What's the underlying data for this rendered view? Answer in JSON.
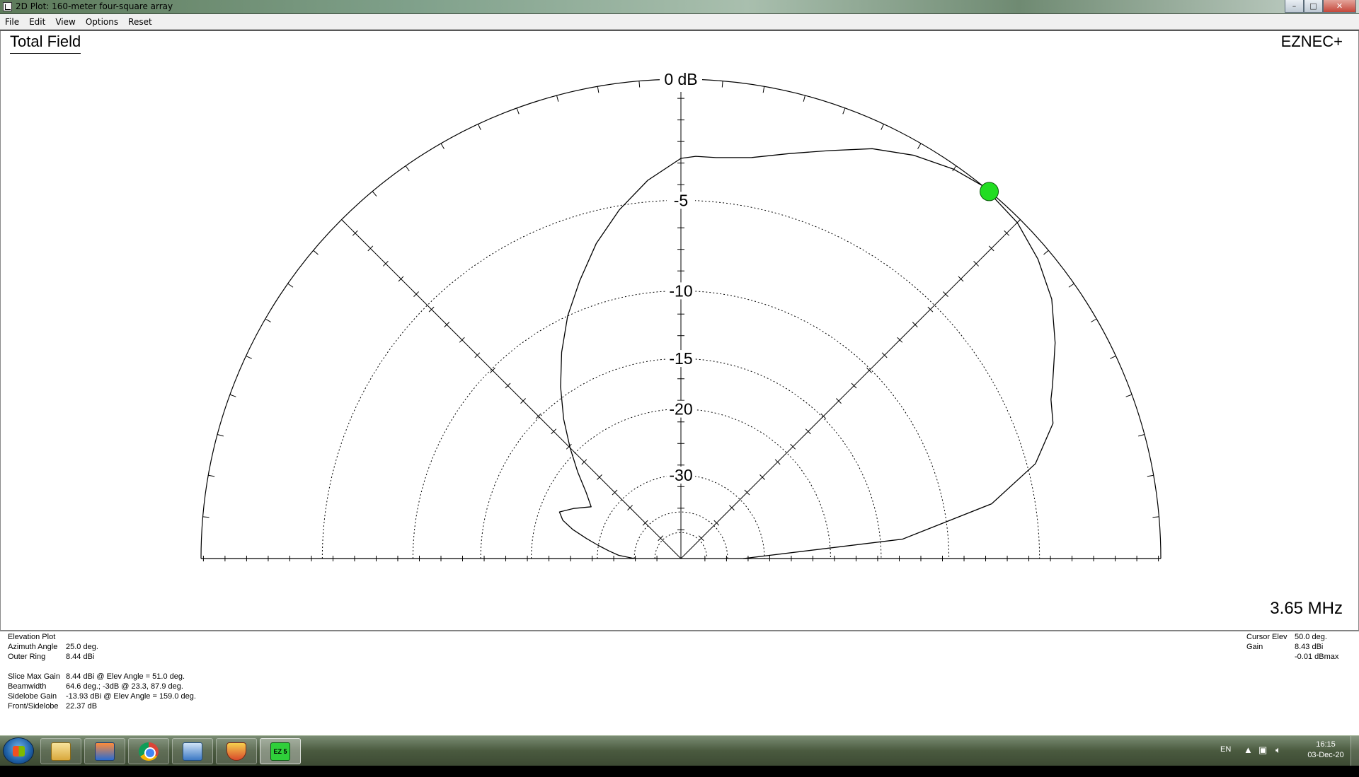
{
  "window": {
    "title": "2D Plot: 160-meter four-square array",
    "minimize_glyph": "–",
    "maximize_glyph": "□",
    "close_glyph": "✕"
  },
  "menu": [
    "File",
    "Edit",
    "View",
    "Options",
    "Reset"
  ],
  "plot": {
    "title": "Total Field",
    "program": "EZNEC+",
    "frequency": "3.65 MHz",
    "cursor_color": "#22dd22"
  },
  "chart_data": {
    "type": "polar",
    "projection": "elevation half-plane",
    "ring_labels": [
      "0 dB",
      "-5",
      "-10",
      "-15",
      "-20",
      "-30"
    ],
    "ring_values_db": [
      0,
      -5,
      -10,
      -15,
      -20,
      -30
    ],
    "extra_rings_db": [
      -40,
      -50
    ],
    "angle_range_deg": [
      0,
      180
    ],
    "cursor": {
      "elevation_deg": 50.0,
      "gain_db_rel_max": -0.01
    },
    "pattern": {
      "elevation_deg": [
        0,
        5,
        10,
        15,
        20,
        23.3,
        25,
        30,
        35,
        40,
        45,
        51,
        55,
        60,
        65,
        70,
        75,
        80,
        85,
        87.9,
        90,
        95,
        100,
        105,
        110,
        115,
        120,
        125,
        130,
        135,
        140,
        145,
        150,
        155,
        159,
        162,
        165,
        168,
        171,
        174,
        177,
        180
      ],
      "gain_db_rel_max": [
        -35,
        -13.2,
        -7.2,
        -4.6,
        -3.3,
        -3.0,
        -2.7,
        -1.8,
        -1.0,
        -0.5,
        -0.15,
        0,
        -0.15,
        -0.5,
        -1.0,
        -1.7,
        -2.3,
        -2.8,
        -3.0,
        -3.0,
        -3.1,
        -4.0,
        -5.2,
        -6.6,
        -8.3,
        -10.0,
        -12.0,
        -14.2,
        -16.6,
        -19.2,
        -21.8,
        -24.4,
        -26.3,
        -24.0,
        -22.4,
        -23.2,
        -25.0,
        -27.5,
        -30.0,
        -32.5,
        -35.0,
        -40.0
      ]
    }
  },
  "info": {
    "plot_type": "Elevation Plot",
    "azimuth_angle": {
      "label": "Azimuth Angle",
      "value": "25.0 deg."
    },
    "outer_ring": {
      "label": "Outer Ring",
      "value": "8.44 dBi"
    },
    "slice_max_gain": {
      "label": "Slice Max Gain",
      "value": "8.44 dBi @ Elev Angle = 51.0 deg."
    },
    "beamwidth": {
      "label": "Beamwidth",
      "value": "64.6 deg.; -3dB @ 23.3, 87.9 deg."
    },
    "sidelobe_gain": {
      "label": "Sidelobe Gain",
      "value": "-13.93 dBi @ Elev Angle = 159.0 deg."
    },
    "front_sidelobe": {
      "label": "Front/Sidelobe",
      "value": "22.37 dB"
    },
    "cursor_elev": {
      "label": "Cursor Elev",
      "value": "50.0 deg."
    },
    "gain": {
      "label": "Gain",
      "value": "8.43 dBi",
      "value2": "-0.01 dBmax"
    }
  },
  "taskbar": {
    "apps": [
      "file-explorer",
      "remote-app",
      "chrome",
      "network-tool",
      "security-shield",
      "eznec"
    ],
    "eznec_badge": "EZ 5",
    "language": "EN",
    "time": "16:15",
    "date": "03-Dec-20"
  }
}
